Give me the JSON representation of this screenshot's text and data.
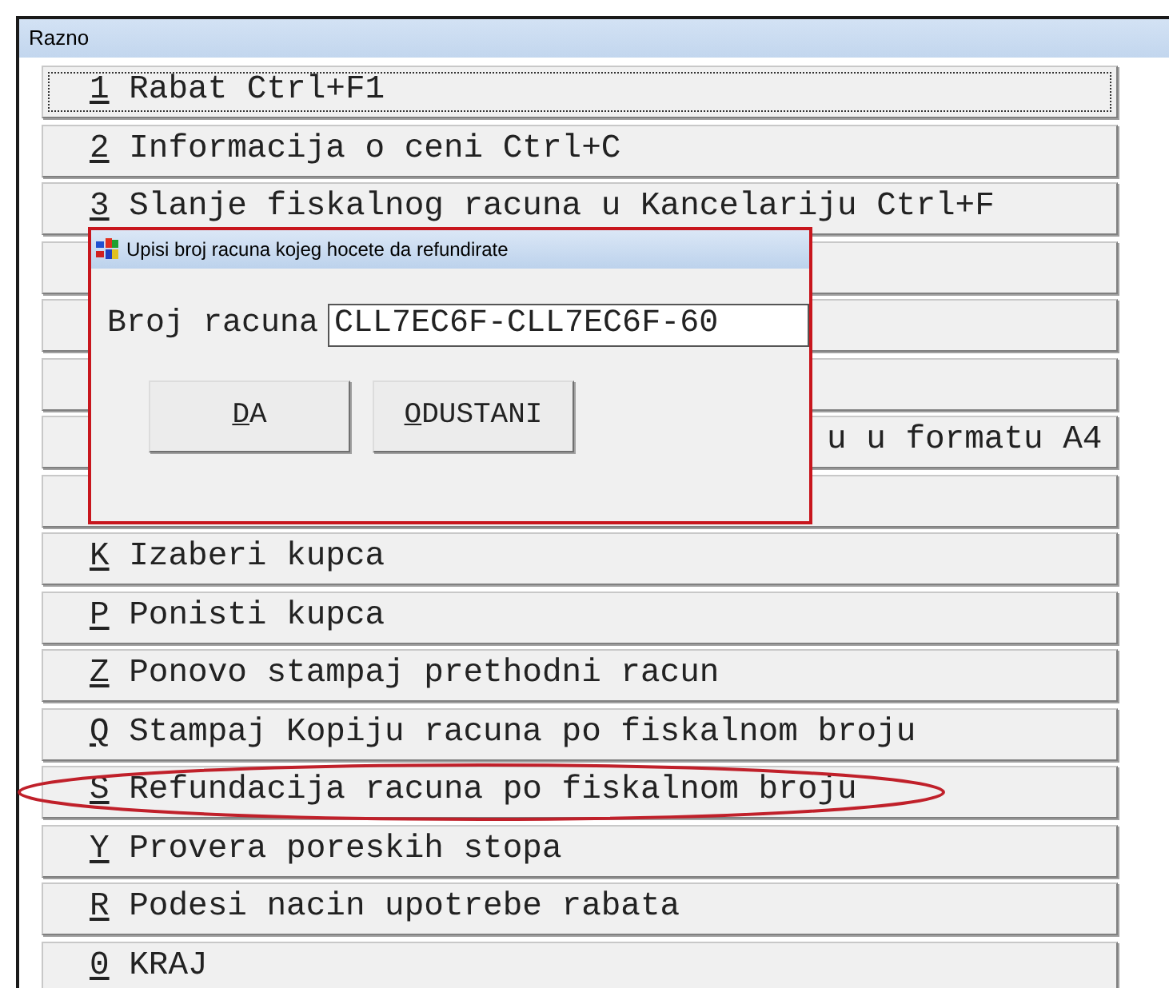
{
  "window": {
    "title": "Razno"
  },
  "menu_items": [
    {
      "kind": "normal",
      "key": "1",
      "label": "Rabat Ctrl+F1",
      "focused": true,
      "circled": false
    },
    {
      "kind": "normal",
      "key": "2",
      "label": "Informacija o ceni Ctrl+C",
      "focused": false,
      "circled": false
    },
    {
      "kind": "normal",
      "key": "3",
      "label": "Slanje fiskalnog racuna u Kancelariju Ctrl+F",
      "focused": false,
      "circled": false
    },
    {
      "kind": "covered"
    },
    {
      "kind": "covered"
    },
    {
      "kind": "covered"
    },
    {
      "kind": "covered",
      "label": "u u formatu A4"
    },
    {
      "kind": "covered"
    },
    {
      "kind": "normal",
      "key": "K",
      "label": "Izaberi kupca",
      "focused": false,
      "circled": false
    },
    {
      "kind": "normal",
      "key": "P",
      "label": "Ponisti kupca",
      "focused": false,
      "circled": false
    },
    {
      "kind": "normal",
      "key": "Z",
      "label": "Ponovo stampaj prethodni racun",
      "focused": false,
      "circled": false
    },
    {
      "kind": "normal",
      "key": "Q",
      "label": "Stampaj Kopiju racuna po fiskalnom broju",
      "focused": false,
      "circled": false
    },
    {
      "kind": "normal",
      "key": "S",
      "label": "Refundacija racuna po fiskalnom broju",
      "focused": false,
      "circled": true
    },
    {
      "kind": "normal",
      "key": "Y",
      "label": "Provera poreskih stopa",
      "focused": false,
      "circled": false
    },
    {
      "kind": "normal",
      "key": "R",
      "label": "Podesi nacin upotrebe rabata",
      "focused": false,
      "circled": false
    },
    {
      "kind": "normal",
      "key": "0",
      "label": "KRAJ",
      "focused": false,
      "circled": false
    }
  ],
  "dialog": {
    "title": "Upisi broj racuna kojeg hocete da refundirate",
    "field_label": "Broj racuna",
    "field_value": "CLL7EC6F-CLL7EC6F-60",
    "buttons": [
      {
        "label": "DA"
      },
      {
        "label": "ODUSTANI"
      }
    ]
  }
}
